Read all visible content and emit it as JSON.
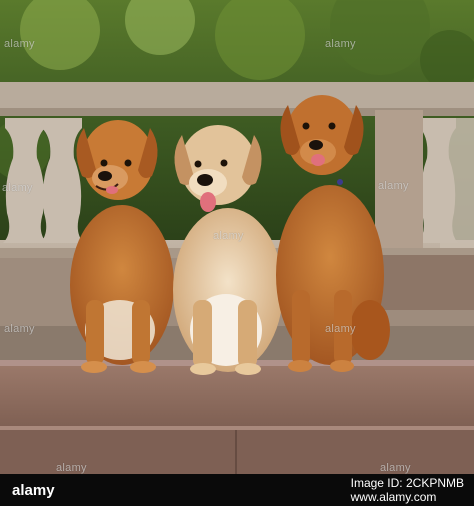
{
  "watermark": {
    "text": "alamy"
  },
  "footer": {
    "brand": "alamy",
    "image_id_label": "Image ID:",
    "image_id": "2CKPNMB",
    "site": "www.alamy.com"
  },
  "colors": {
    "foliage_dark": "#2f4a1c",
    "foliage_light": "#7a9a3a",
    "stone": "#b9aa9a",
    "step": "#8f6f62",
    "fur_red": "#b8652a",
    "fur_light": "#e2c9a6"
  }
}
